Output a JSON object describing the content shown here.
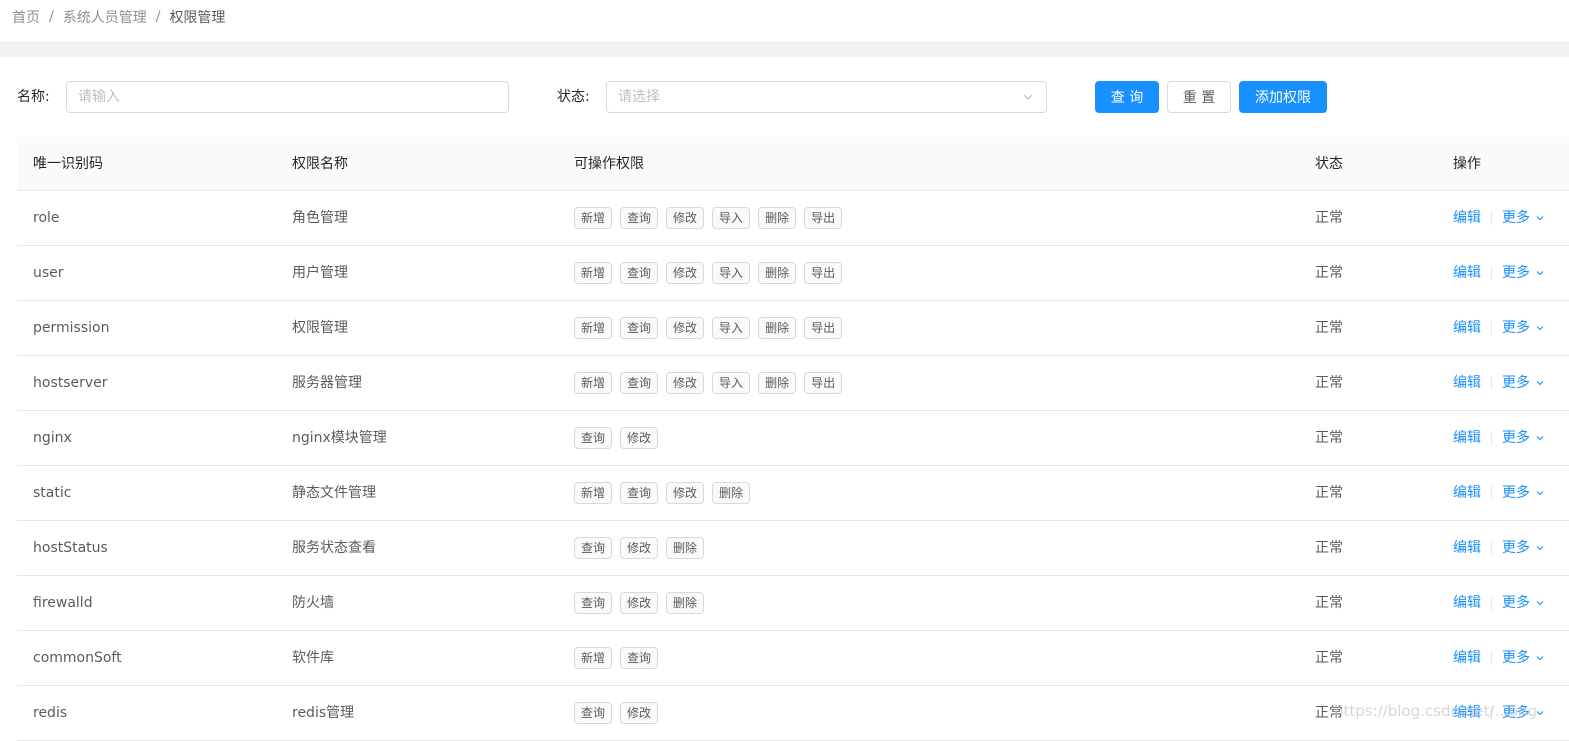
{
  "breadcrumb": {
    "items": [
      "首页",
      "系统人员管理",
      "权限管理"
    ],
    "separator": "/"
  },
  "search": {
    "name_label": "名称:",
    "name_placeholder": "请输入",
    "status_label": "状态:",
    "status_placeholder": "请选择",
    "query_button": "查 询",
    "reset_button": "重 置",
    "add_button": "添加权限"
  },
  "table": {
    "columns": [
      "唯一识别码",
      "权限名称",
      "可操作权限",
      "状态",
      "操作"
    ],
    "rows": [
      {
        "code": "role",
        "name": "角色管理",
        "perms": [
          "新增",
          "查询",
          "修改",
          "导入",
          "删除",
          "导出"
        ],
        "status": "正常"
      },
      {
        "code": "user",
        "name": "用户管理",
        "perms": [
          "新增",
          "查询",
          "修改",
          "导入",
          "删除",
          "导出"
        ],
        "status": "正常"
      },
      {
        "code": "permission",
        "name": "权限管理",
        "perms": [
          "新增",
          "查询",
          "修改",
          "导入",
          "删除",
          "导出"
        ],
        "status": "正常"
      },
      {
        "code": "hostserver",
        "name": "服务器管理",
        "perms": [
          "新增",
          "查询",
          "修改",
          "导入",
          "删除",
          "导出"
        ],
        "status": "正常"
      },
      {
        "code": "nginx",
        "name": "nginx模块管理",
        "perms": [
          "查询",
          "修改"
        ],
        "status": "正常"
      },
      {
        "code": "static",
        "name": "静态文件管理",
        "perms": [
          "新增",
          "查询",
          "修改",
          "删除"
        ],
        "status": "正常"
      },
      {
        "code": "hostStatus",
        "name": "服务状态查看",
        "perms": [
          "查询",
          "修改",
          "删除"
        ],
        "status": "正常"
      },
      {
        "code": "firewalld",
        "name": "防火墙",
        "perms": [
          "查询",
          "修改",
          "删除"
        ],
        "status": "正常"
      },
      {
        "code": "commonSoft",
        "name": "软件库",
        "perms": [
          "新增",
          "查询"
        ],
        "status": "正常"
      },
      {
        "code": "redis",
        "name": "redis管理",
        "perms": [
          "查询",
          "修改"
        ],
        "status": "正常"
      }
    ],
    "actions": {
      "edit": "编辑",
      "more": "更多"
    }
  },
  "watermark": "https://blog.csdn.net/...ong",
  "colors": {
    "primary": "#1890ff",
    "page_bg": "#f0f2f5",
    "header_bg": "#fafafa",
    "border": "#e8e8e8"
  }
}
